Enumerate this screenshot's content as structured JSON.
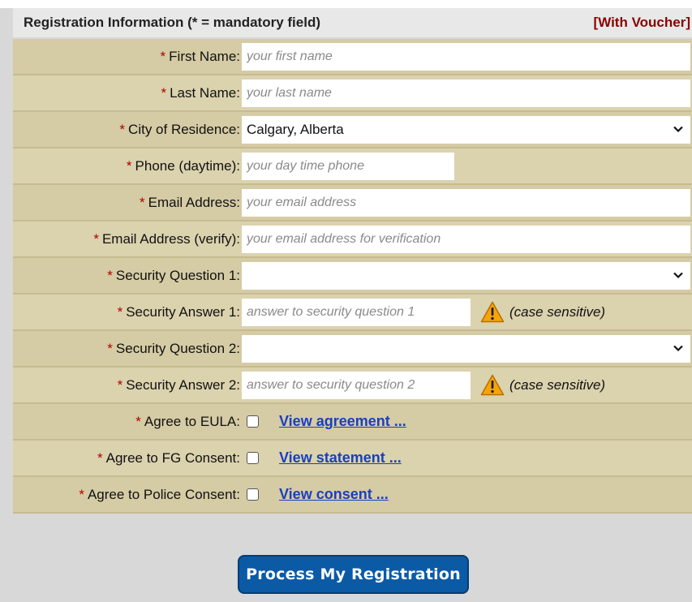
{
  "header": {
    "title": "Registration Information (* = mandatory field)",
    "voucher": "[With Voucher]"
  },
  "required_mark": "*",
  "fields": {
    "first_name": {
      "label": "First Name:",
      "placeholder": "your first name"
    },
    "last_name": {
      "label": "Last Name:",
      "placeholder": "your last name"
    },
    "city": {
      "label": "City of Residence:",
      "value": "Calgary, Alberta"
    },
    "phone": {
      "label": "Phone (daytime):",
      "placeholder": "your day time phone"
    },
    "email": {
      "label": "Email Address:",
      "placeholder": "your email address"
    },
    "email_verify": {
      "label": "Email Address (verify):",
      "placeholder": "your email address for verification"
    },
    "sec_q1": {
      "label": "Security Question 1:",
      "value": ""
    },
    "sec_a1": {
      "label": "Security Answer 1:",
      "placeholder": "answer to security question 1",
      "note": "(case sensitive)"
    },
    "sec_q2": {
      "label": "Security Question 2:",
      "value": ""
    },
    "sec_a2": {
      "label": "Security Answer 2:",
      "placeholder": "answer to security question 2",
      "note": "(case sensitive)"
    },
    "eula": {
      "label": "Agree to EULA:",
      "link": "View agreement ...",
      "checked": false
    },
    "fg": {
      "label": "Agree to FG Consent:",
      "link": "View statement ...",
      "checked": false
    },
    "police": {
      "label": "Agree to Police Consent:",
      "link": "View consent ...",
      "checked": false
    }
  },
  "submit_label": "Process My Registration",
  "icons": {
    "warning": "warning-icon",
    "chevron": "chevron-down-icon"
  },
  "colors": {
    "row_bg": "#d5cba4",
    "header_bg": "#e8e8e8",
    "required": "#b00000",
    "voucher": "#8b0000",
    "link": "#1a3fbf",
    "button": "#0b5aa6"
  }
}
